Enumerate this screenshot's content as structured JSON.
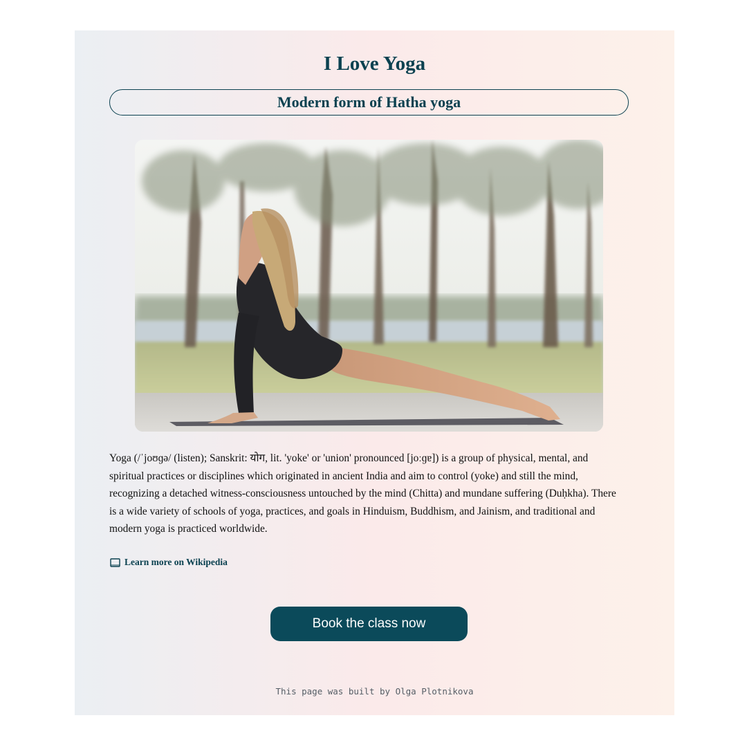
{
  "page": {
    "title": "I Love Yoga",
    "subtitle": "Modern form of Hatha yoga"
  },
  "hero_image": {
    "description_icon": "yoga-pose-photo"
  },
  "article": {
    "text": "Yoga (/ˈjoʊɡə/ (listen); Sanskrit: योग, lit. 'yoke' or 'union' pronounced [joːɡɐ]) is a group of physical, mental, and spiritual practices or disciplines which originated in ancient India and aim to control (yoke) and still the mind, recognizing a detached witness-consciousness untouched by the mind (Chitta) and mundane suffering (Duḥkha). There is a wide variety of schools of yoga, practices, and goals in Hinduism, Buddhism, and Jainism, and traditional and modern yoga is practiced worldwide."
  },
  "link": {
    "label": "Learn more on Wikipedia",
    "icon": "book-icon"
  },
  "cta": {
    "label": "Book the class now"
  },
  "footer": {
    "text": "This page was built by Olga Plotnikova"
  },
  "colors": {
    "accent": "#0b4150",
    "button": "#0b4a5a"
  }
}
